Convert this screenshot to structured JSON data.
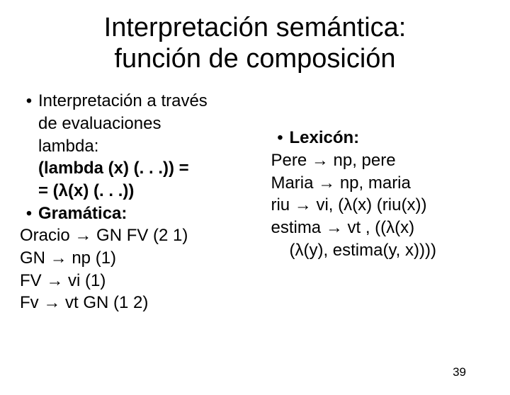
{
  "title_line1": "Interpretación semántica:",
  "title_line2": "función de composición",
  "left": {
    "b1_l1": "Interpretación a través",
    "b1_l2": "de evaluaciones",
    "b1_l3": "lambda:",
    "lam1": "(lambda (x) (. . .)) =",
    "lam2": "= (λ(x) (. . .))",
    "b2": "Gramática:",
    "g1": "Oracio  → GN FV (2 1)",
    "g2": "GN → np (1)",
    "g3": "FV → vi (1)",
    "g4": "Fv → vt GN (1 2)"
  },
  "right": {
    "b1": "Lexicón:",
    "l1": "Pere → np, pere",
    "l2": "Maria → np, maria",
    "l3": "riu → vi, (λ(x) (riu(x))",
    "l4a": "estima → vt , ((λ(x)",
    "l4b": "(λ(y), estima(y, x))))"
  },
  "page": "39"
}
